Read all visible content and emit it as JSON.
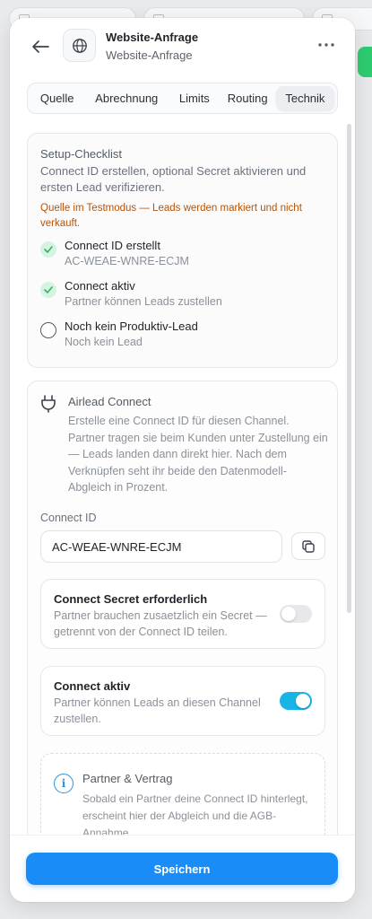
{
  "colors": {
    "accent": "#1a8cf7",
    "toggle_on": "#16b5e6",
    "warning": "#b45309",
    "success_bg": "#d6f3e1",
    "success_check": "#2fb36b"
  },
  "header": {
    "title": "Website-Anfrage",
    "subtitle": "Website-Anfrage",
    "back_icon": "arrow-left-icon",
    "source_icon": "globe-icon",
    "more_icon": "more-horizontal-icon"
  },
  "tabs": [
    {
      "label": "Quelle",
      "active": false
    },
    {
      "label": "Abrechnung",
      "active": false
    },
    {
      "label": "Limits",
      "active": false
    },
    {
      "label": "Routing",
      "active": false
    },
    {
      "label": "Technik",
      "active": true
    }
  ],
  "setup_checklist": {
    "title": "Setup-Checklist",
    "description": "Connect ID erstellen, optional Secret aktivieren und ersten Lead verifizieren.",
    "warning": "Quelle im Testmodus — Leads werden markiert und nicht verkauft.",
    "items": [
      {
        "label": "Connect ID erstellt",
        "sub": "AC-WEAE-WNRE-ECJM",
        "done": true
      },
      {
        "label": "Connect aktiv",
        "sub": "Partner können Leads zustellen",
        "done": true
      },
      {
        "label": "Noch kein Produktiv-Lead",
        "sub": "Noch kein Lead",
        "done": false
      }
    ]
  },
  "airlead_connect": {
    "icon": "plug-icon",
    "title": "Airlead Connect",
    "description": "Erstelle eine Connect ID für diesen Channel. Partner tragen sie beim Kunden unter Zustellung ein — Leads landen dann direkt hier. Nach dem Verknüpfen seht ihr beide den Datenmodell-Abgleich in Prozent.",
    "connect_id_label": "Connect ID",
    "connect_id_value": "AC-WEAE-WNRE-ECJM",
    "copy_icon": "copy-icon",
    "secret_toggle": {
      "title": "Connect Secret erforderlich",
      "description": "Partner brauchen zusaetzlich ein Secret — getrennt von der Connect ID teilen.",
      "on": false
    },
    "active_toggle": {
      "title": "Connect aktiv",
      "description": "Partner können Leads an diesen Channel zustellen.",
      "on": true
    },
    "partner": {
      "icon": "info-icon",
      "title": "Partner & Vertrag",
      "description": "Sobald ein Partner deine Connect ID hinterlegt, erscheint hier der Abgleich und die AGB-Annahme."
    }
  },
  "footer": {
    "save_label": "Speichern"
  }
}
